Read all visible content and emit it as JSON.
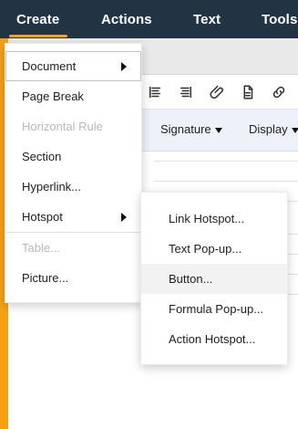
{
  "menubar": {
    "items": [
      {
        "label": "Create"
      },
      {
        "label": "Actions"
      },
      {
        "label": "Text"
      },
      {
        "label": "Tools"
      }
    ]
  },
  "toolbar2": {
    "signature_label": "Signature",
    "display_label": "Display"
  },
  "create_menu": {
    "items": [
      {
        "label": "Document",
        "disabled": false,
        "has_submenu": true
      },
      {
        "label": "Page Break",
        "disabled": false,
        "has_submenu": false
      },
      {
        "label": "Horizontal Rule",
        "disabled": true,
        "has_submenu": false
      },
      {
        "label": "Section",
        "disabled": false,
        "has_submenu": false
      },
      {
        "label": "Hyperlink...",
        "disabled": false,
        "has_submenu": false
      },
      {
        "label": "Hotspot",
        "disabled": false,
        "has_submenu": true
      },
      {
        "label": "Table...",
        "disabled": true,
        "has_submenu": false
      },
      {
        "label": "Picture...",
        "disabled": false,
        "has_submenu": false
      }
    ]
  },
  "hotspot_menu": {
    "items": [
      {
        "label": "Link Hotspot..."
      },
      {
        "label": "Text Pop-up..."
      },
      {
        "label": "Button..."
      },
      {
        "label": "Formula Pop-up..."
      },
      {
        "label": "Action Hotspot..."
      }
    ]
  },
  "icons": {
    "toolbar": [
      "align-left-icon",
      "align-right-icon",
      "paperclip-icon",
      "page-icon",
      "link-icon"
    ]
  },
  "colors": {
    "accent": "#f6a114",
    "menubar_bg": "#223343",
    "menu_text": "#202020",
    "disabled_text": "#b9b9b9",
    "hover_bg": "#f2f2f2",
    "toolbar2_bg": "#eef1f9"
  }
}
